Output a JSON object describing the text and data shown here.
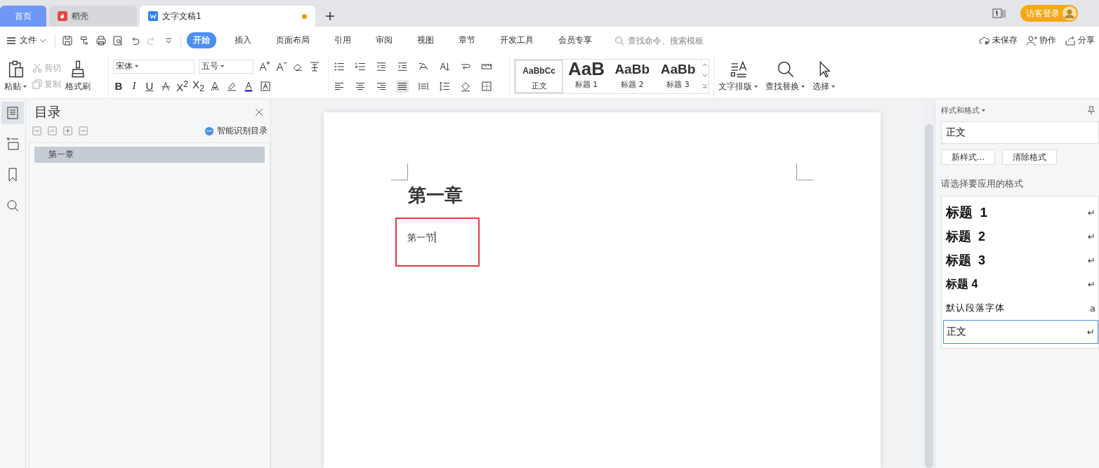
{
  "tabs": [
    {
      "label": "首页",
      "kind": "home",
      "selected": false
    },
    {
      "label": "稻壳",
      "kind": "app",
      "selected": false
    },
    {
      "label": "文字文稿1",
      "kind": "doc",
      "selected": true,
      "modified": true
    }
  ],
  "login": "访客登录",
  "menu": {
    "file": "文件",
    "tabs": [
      {
        "label": "开始",
        "selected": true
      },
      {
        "label": "插入",
        "selected": false
      },
      {
        "label": "页面布局",
        "selected": false
      },
      {
        "label": "引用",
        "selected": false
      },
      {
        "label": "审阅",
        "selected": false
      },
      {
        "label": "视图",
        "selected": false
      },
      {
        "label": "章节",
        "selected": false
      },
      {
        "label": "开发工具",
        "selected": false
      },
      {
        "label": "会员专享",
        "selected": false
      }
    ],
    "search_placeholder": "查找命令、搜索模板",
    "actions": [
      "未保存",
      "协作",
      "分享"
    ]
  },
  "ribbon": {
    "paste": "粘贴",
    "cut": {
      "label": "剪切",
      "disabled": true
    },
    "copy": {
      "label": "复制",
      "disabled": true
    },
    "format_painter": "格式刷",
    "font": "宋体",
    "size": "五号",
    "bold": "B",
    "italic": "I",
    "underline": "U",
    "superscript": "X$^{2}$",
    "subscript": "X$_{2}$",
    "styles": [
      {
        "preview": "AaBbCc",
        "label": "正文",
        "kind": "normal",
        "selected": true
      },
      {
        "preview": "AaB",
        "label": "标题 1",
        "kind": "h1",
        "selected": false
      },
      {
        "preview": "AaBb",
        "label": "标题 2",
        "kind": "h2",
        "selected": false
      },
      {
        "preview": "AaBb",
        "label": "标题 3",
        "kind": "h3",
        "selected": false
      }
    ],
    "layout": "文字排版",
    "find": "查找替换",
    "select": "选择"
  },
  "toc": {
    "title": "目录",
    "smart": "智能识别目录",
    "items": [
      {
        "label": "第一章",
        "selected": true
      }
    ]
  },
  "document": {
    "heading": "第一章",
    "paragraph": "第一节",
    "highlighted": true
  },
  "styles_panel": {
    "title": "样式和格式",
    "current": "正文",
    "buttons": [
      "新样式...",
      "清除格式"
    ],
    "prompt": "请选择要应用的格式",
    "items": [
      {
        "label": "标题  1",
        "kind": "h1",
        "mark": "↵",
        "selected": false
      },
      {
        "label": "标题  2",
        "kind": "h2",
        "mark": "↵",
        "selected": false
      },
      {
        "label": "标题  3",
        "kind": "h3",
        "mark": "↵",
        "selected": false
      },
      {
        "label": "标题 4",
        "kind": "h4",
        "mark": "↵",
        "selected": false
      },
      {
        "label": "默认段落字体",
        "kind": "char",
        "mark": "a",
        "selected": false
      },
      {
        "label": "正文",
        "kind": "para",
        "mark": "↵",
        "selected": true
      }
    ]
  }
}
